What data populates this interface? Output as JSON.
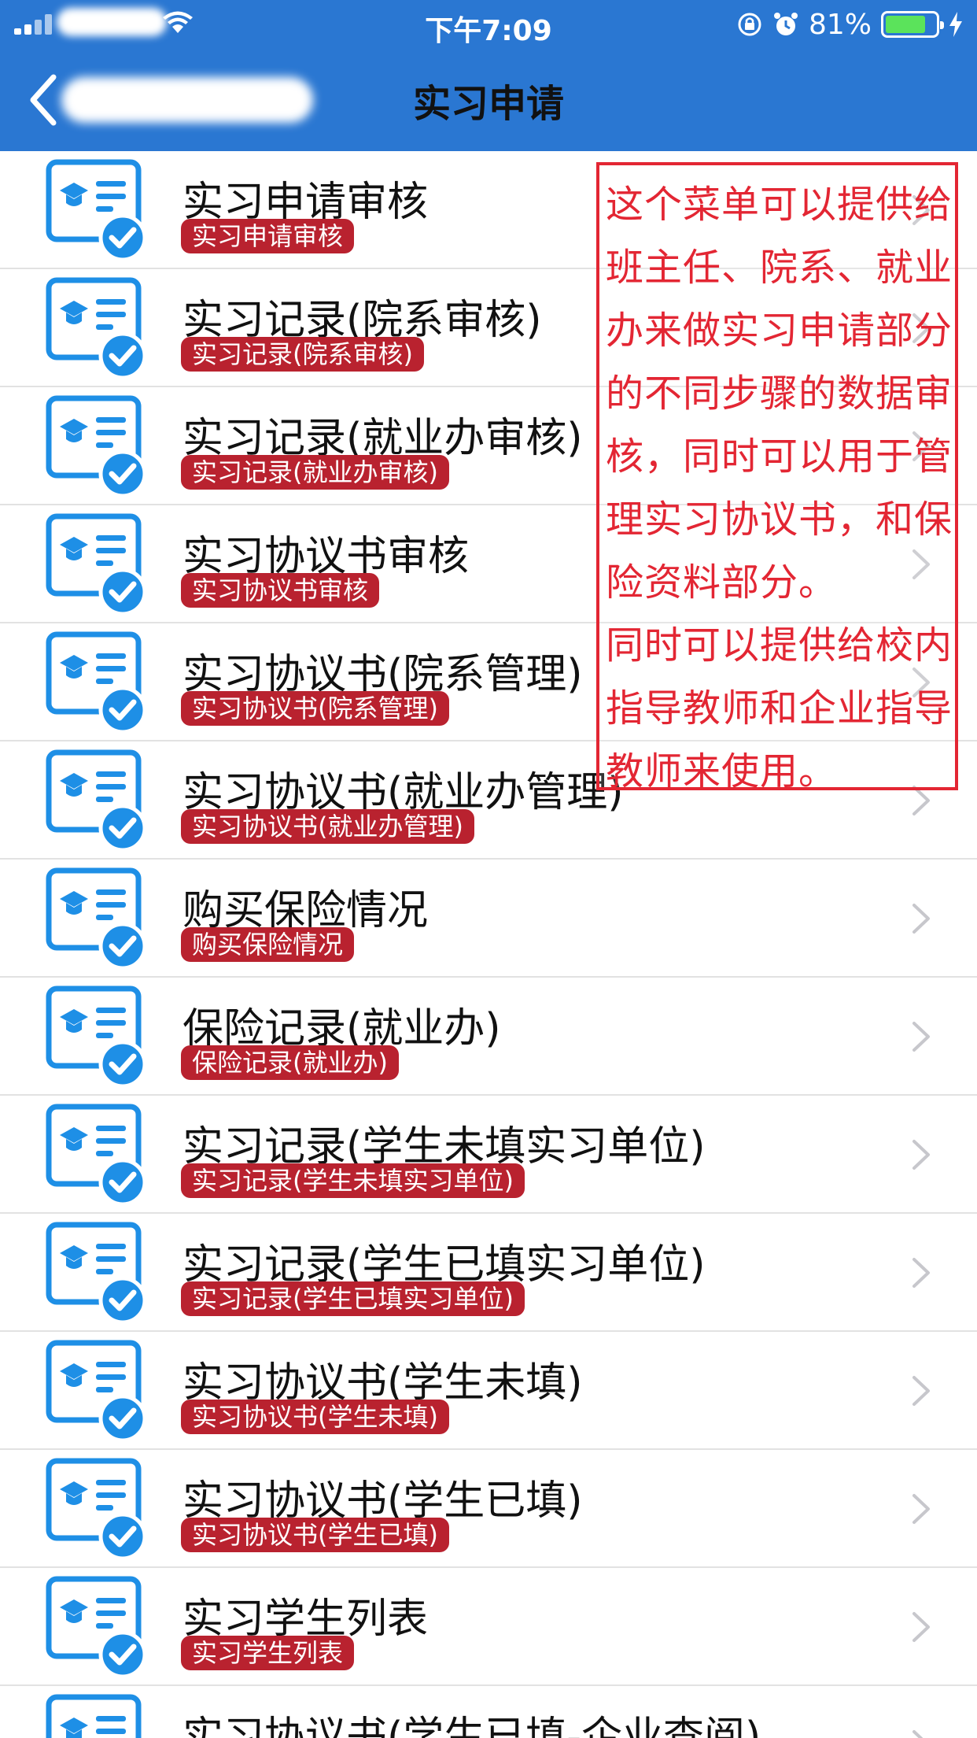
{
  "status_bar": {
    "time": "下午7:09",
    "battery": "81%"
  },
  "nav": {
    "title": "实习申请"
  },
  "items": [
    {
      "title": "实习申请审核",
      "badge": "实习申请审核"
    },
    {
      "title": "实习记录(院系审核)",
      "badge": "实习记录(院系审核)"
    },
    {
      "title": "实习记录(就业办审核)",
      "badge": "实习记录(就业办审核)"
    },
    {
      "title": "实习协议书审核",
      "badge": "实习协议书审核"
    },
    {
      "title": "实习协议书(院系管理)",
      "badge": "实习协议书(院系管理)"
    },
    {
      "title": "实习协议书(就业办管理)",
      "badge": "实习协议书(就业办管理)"
    },
    {
      "title": "购买保险情况",
      "badge": "购买保险情况"
    },
    {
      "title": "保险记录(就业办)",
      "badge": "保险记录(就业办)"
    },
    {
      "title": "实习记录(学生未填实习单位)",
      "badge": "实习记录(学生未填实习单位)"
    },
    {
      "title": "实习记录(学生已填实习单位)",
      "badge": "实习记录(学生已填实习单位)"
    },
    {
      "title": "实习协议书(学生未填)",
      "badge": "实习协议书(学生未填)"
    },
    {
      "title": "实习协议书(学生已填)",
      "badge": "实习协议书(学生已填)"
    },
    {
      "title": "实习学生列表",
      "badge": "实习学生列表"
    },
    {
      "title": "实习协议书(学生已填-企业查阅)",
      "badge": ""
    }
  ],
  "annotation": {
    "lines": [
      "这个菜单可以提供给",
      "班主任、院系、就业",
      "办来做实习申请部分",
      "的不同步骤的数据审",
      "核，同时可以用于管",
      "理实习协议书，和保",
      "险资料部分。",
      "同时可以提供给校内",
      "指导教师和企业指导",
      "教师来使用。"
    ]
  },
  "colors": {
    "header": "#2a77d2",
    "badge": "#b9222f",
    "annotation": "#e32633",
    "icon_blue": "#1e8fe6"
  },
  "icons": {
    "item": "certificate-check-icon",
    "chevron": "chevron-right-icon",
    "back": "chevron-left-icon"
  }
}
